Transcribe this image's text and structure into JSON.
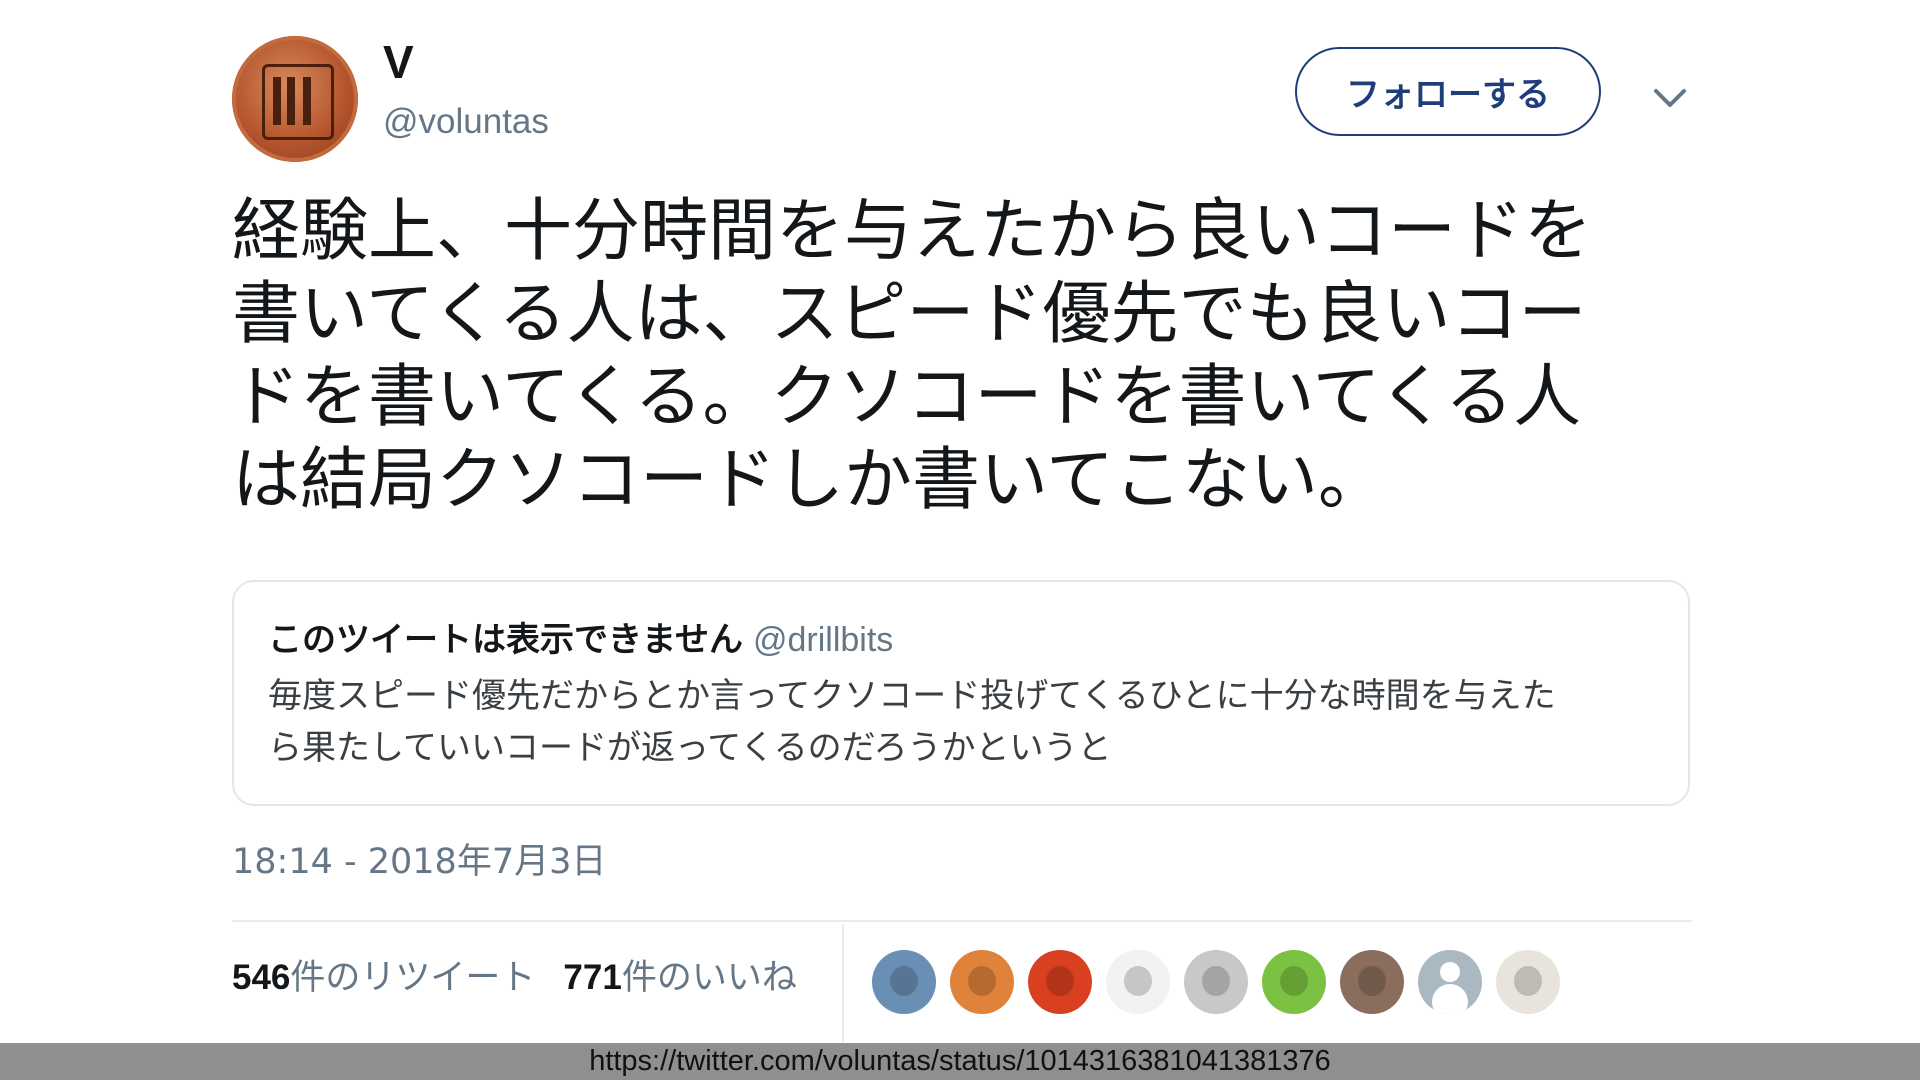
{
  "tweet": {
    "display_name": "V",
    "handle": "@voluntas",
    "follow_label": "フォローする",
    "text": "経験上、十分時間を与えたから良いコードを\n書いてくる人は、スピード優先でも良いコー\nドを書いてくる。クソコードを書いてくる人\nは結局クソコードしか書いてこない。",
    "timestamp": "18:14 - 2018年7月3日"
  },
  "quoted": {
    "title": "このツイートは表示できません",
    "handle": "@drillbits",
    "text": "毎度スピード優先だからとか言ってクソコード投げてくるひとに十分な時間を与えた\nら果たしていいコードが返ってくるのだろうかというと"
  },
  "stats": {
    "retweets_count": "546",
    "retweets_label": "件のリツイート",
    "likes_count": "771",
    "likes_label": "件のいいね"
  },
  "likers": [
    {
      "icon": "person-photo-avatar",
      "color": "#6a8fb5"
    },
    {
      "icon": "mustache-face-avatar",
      "color": "#e0823a"
    },
    {
      "icon": "red-mascot-avatar",
      "color": "#d8401f"
    },
    {
      "icon": "cartoon-boy-avatar",
      "color": "#f2f2f2"
    },
    {
      "icon": "retro-computer-avatar",
      "color": "#c8c8c8"
    },
    {
      "icon": "green-frog-avatar",
      "color": "#7cc242"
    },
    {
      "icon": "group-photo-avatar",
      "color": "#8a6d5c"
    },
    {
      "icon": "default-user-avatar",
      "color": "#aab8c2"
    },
    {
      "icon": "pattern-avatar",
      "color": "#e8e4dc"
    }
  ],
  "source_url": "https://twitter.com/voluntas/status/1014316381041381376",
  "colors": {
    "follow_accent": "#1f3d7a",
    "secondary_text": "#657786",
    "border": "#e1e8ed",
    "url_bar_bg": "#8f8f8f"
  }
}
